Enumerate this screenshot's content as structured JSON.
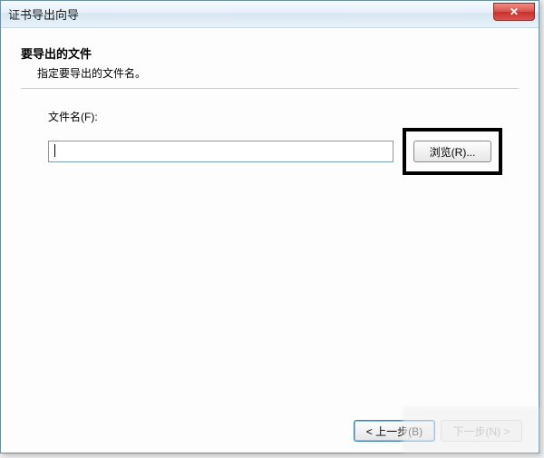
{
  "window": {
    "title": "证书导出向导"
  },
  "header": {
    "heading": "要导出的文件",
    "subheading": "指定要导出的文件名。"
  },
  "form": {
    "filename_label": "文件名(F):",
    "filename_value": "",
    "browse_label": "浏览(R)..."
  },
  "footer": {
    "back_label": "< 上一步(B)",
    "next_label": "下一步(N) >"
  },
  "icons": {
    "close_glyph": "✕"
  }
}
